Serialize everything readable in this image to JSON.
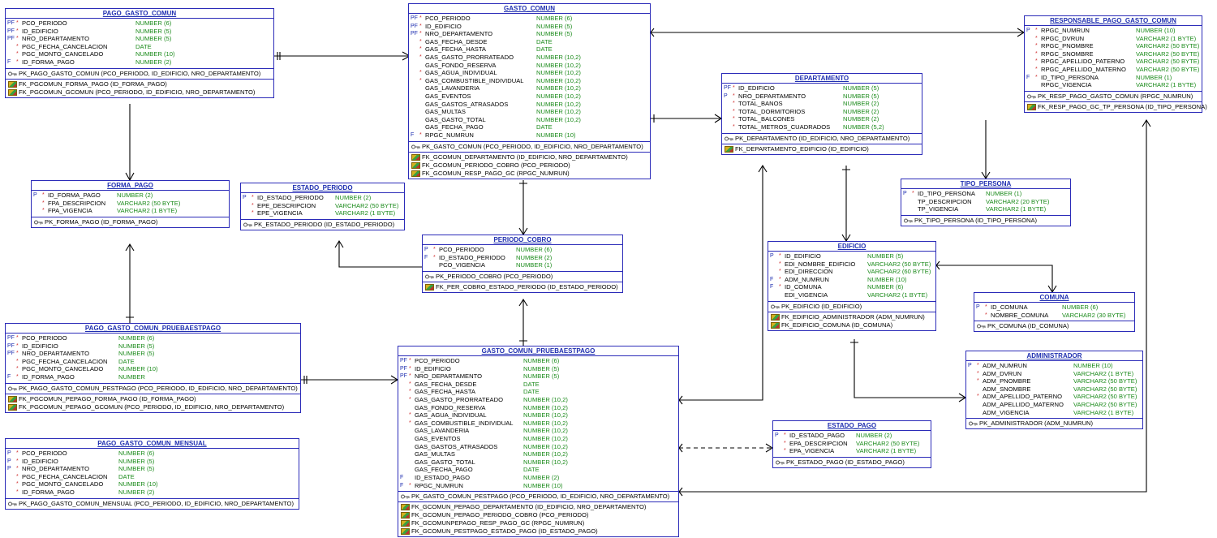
{
  "tables": [
    {
      "id": "pago_gasto_comun",
      "name": "PAGO_GASTO_COMUN",
      "columns": [
        [
          "PF",
          "*",
          "PCO_PERIODO",
          "NUMBER (6)"
        ],
        [
          "PF",
          "*",
          "ID_EDIFICIO",
          "NUMBER (5)"
        ],
        [
          "PF",
          "*",
          "NRO_DEPARTAMENTO",
          "NUMBER (5)"
        ],
        [
          "",
          "*",
          "PGC_FECHA_CANCELACION",
          "DATE"
        ],
        [
          "",
          "*",
          "PGC_MONTO_CANCELADO",
          "NUMBER (10)"
        ],
        [
          "F",
          "*",
          "ID_FORMA_PAGO",
          "NUMBER (2)"
        ]
      ],
      "pk": [
        "PK_PAGO_GASTO_COMUN (PCO_PERIODO, ID_EDIFICIO, NRO_DEPARTAMENTO)"
      ],
      "fk": [
        "FK_PGCOMUN_FORMA_PAGO (ID_FORMA_PAGO)",
        "FK_PGCOMUN_GCOMUN (PCO_PERIODO, ID_EDIFICIO, NRO_DEPARTAMENTO)"
      ]
    },
    {
      "id": "gasto_comun",
      "name": "GASTO_COMUN",
      "columns": [
        [
          "PF",
          "*",
          "PCO_PERIODO",
          "NUMBER (6)"
        ],
        [
          "PF",
          "*",
          "ID_EDIFICIO",
          "NUMBER (5)"
        ],
        [
          "PF",
          "*",
          "NRO_DEPARTAMENTO",
          "NUMBER (5)"
        ],
        [
          "",
          "*",
          "GAS_FECHA_DESDE",
          "DATE"
        ],
        [
          "",
          "*",
          "GAS_FECHA_HASTA",
          "DATE"
        ],
        [
          "",
          "*",
          "GAS_GASTO_PRORRATEADO",
          "NUMBER (10,2)"
        ],
        [
          "",
          "",
          "GAS_FONDO_RESERVA",
          "NUMBER (10,2)"
        ],
        [
          "",
          "*",
          "GAS_AGUA_INDIVIDUAL",
          "NUMBER (10,2)"
        ],
        [
          "",
          "*",
          "GAS_COMBUSTIBLE_INDIVIDUAL",
          "NUMBER (10,2)"
        ],
        [
          "",
          "",
          "GAS_LAVANDERIA",
          "NUMBER (10,2)"
        ],
        [
          "",
          "",
          "GAS_EVENTOS",
          "NUMBER (10,2)"
        ],
        [
          "",
          "",
          "GAS_GASTOS_ATRASADOS",
          "NUMBER (10,2)"
        ],
        [
          "",
          "",
          "GAS_MULTAS",
          "NUMBER (10,2)"
        ],
        [
          "",
          "",
          "GAS_GASTO_TOTAL",
          "NUMBER (10,2)"
        ],
        [
          "",
          "",
          "GAS_FECHA_PAGO",
          "DATE"
        ],
        [
          "F",
          "*",
          "RPGC_NUMRUN",
          "NUMBER (10)"
        ]
      ],
      "pk": [
        "PK_GASTO_COMUN (PCO_PERIODO, ID_EDIFICIO, NRO_DEPARTAMENTO)"
      ],
      "fk": [
        "FK_GCOMUN_DEPARTAMENTO (ID_EDIFICIO, NRO_DEPARTAMENTO)",
        "FK_GCOMUN_PERIODO_COBRO (PCO_PERIODO)",
        "FK_GCOMUN_RESP_PAGO_GC (RPGC_NUMRUN)"
      ]
    },
    {
      "id": "responsable_pago",
      "name": "RESPONSABLE_PAGO_GASTO_COMUN",
      "columns": [
        [
          "P",
          "*",
          "RPGC_NUMRUN",
          "NUMBER (10)"
        ],
        [
          "",
          "*",
          "RPGC_DVRUN",
          "VARCHAR2 (1 BYTE)"
        ],
        [
          "",
          "*",
          "RPGC_PNOMBRE",
          "VARCHAR2 (50 BYTE)"
        ],
        [
          "",
          "*",
          "RPGC_SNOMBRE",
          "VARCHAR2 (50 BYTE)"
        ],
        [
          "",
          "*",
          "RPGC_APELLIDO_PATERNO",
          "VARCHAR2 (50 BYTE)"
        ],
        [
          "",
          "*",
          "RPGC_APELLIDO_MATERNO",
          "VARCHAR2 (50 BYTE)"
        ],
        [
          "F",
          "*",
          "ID_TIPO_PERSONA",
          "NUMBER (1)"
        ],
        [
          "",
          "",
          "RPGC_VIGENCIA",
          "VARCHAR2 (1 BYTE)"
        ]
      ],
      "pk": [
        "PK_RESP_PAGO_GASTO_COMUN (RPGC_NUMRUN)"
      ],
      "fk": [
        "FK_RESP_PAGO_GC_TP_PERSONA (ID_TIPO_PERSONA)"
      ]
    },
    {
      "id": "departamento",
      "name": "DEPARTAMENTO",
      "columns": [
        [
          "PF",
          "*",
          "ID_EDIFICIO",
          "NUMBER (5)"
        ],
        [
          "P",
          "*",
          "NRO_DEPARTAMENTO",
          "NUMBER (5)"
        ],
        [
          "",
          "*",
          "TOTAL_BANOS",
          "NUMBER (2)"
        ],
        [
          "",
          "*",
          "TOTAL_DORMITORIOS",
          "NUMBER (2)"
        ],
        [
          "",
          "*",
          "TOTAL_BALCONES",
          "NUMBER (2)"
        ],
        [
          "",
          "*",
          "TOTAL_METROS_CUADRADOS",
          "NUMBER (5,2)"
        ]
      ],
      "pk": [
        "PK_DEPARTAMENTO (ID_EDIFICIO, NRO_DEPARTAMENTO)"
      ],
      "fk": [
        "FK_DEPARTAMENTO_EDIFICIO (ID_EDIFICIO)"
      ]
    },
    {
      "id": "forma_pago",
      "name": "FORMA_PAGO",
      "columns": [
        [
          "P",
          "*",
          "ID_FORMA_PAGO",
          "NUMBER (2)"
        ],
        [
          "",
          "*",
          "FPA_DESCRIPCION",
          "VARCHAR2 (50 BYTE)"
        ],
        [
          "",
          "*",
          "FPA_VIGENCIA",
          "VARCHAR2 (1 BYTE)"
        ]
      ],
      "pk": [
        "PK_FORMA_PAGO (ID_FORMA_PAGO)"
      ],
      "fk": []
    },
    {
      "id": "estado_periodo",
      "name": "ESTADO_PERIODO",
      "columns": [
        [
          "P",
          "*",
          "ID_ESTADO_PERIODO",
          "NUMBER (2)"
        ],
        [
          "",
          "*",
          "EPE_DESCRIPCION",
          "VARCHAR2 (50 BYTE)"
        ],
        [
          "",
          "*",
          "EPE_VIGENCIA",
          "VARCHAR2 (1 BYTE)"
        ]
      ],
      "pk": [
        "PK_ESTADO_PERIODO (ID_ESTADO_PERIODO)"
      ],
      "fk": []
    },
    {
      "id": "tipo_persona",
      "name": "TIPO_PERSONA",
      "columns": [
        [
          "P",
          "*",
          "ID_TIPO_PERSONA",
          "NUMBER (1)"
        ],
        [
          "",
          "",
          "TP_DESCRIPCION",
          "VARCHAR2 (20 BYTE)"
        ],
        [
          "",
          "",
          "TP_VIGENCIA",
          "VARCHAR2 (1 BYTE)"
        ]
      ],
      "pk": [
        "PK_TIPO_PERSONA (ID_TIPO_PERSONA)"
      ],
      "fk": []
    },
    {
      "id": "periodo_cobro",
      "name": "PERIODO_COBRO",
      "columns": [
        [
          "P",
          "*",
          "PCO_PERIODO",
          "NUMBER (6)"
        ],
        [
          "F",
          "*",
          "ID_ESTADO_PERIODO",
          "NUMBER (2)"
        ],
        [
          "",
          "",
          "PCO_VIGENCIA",
          "NUMBER (1)"
        ]
      ],
      "pk": [
        "PK_PERIODO_COBRO (PCO_PERIODO)"
      ],
      "fk": [
        "FK_PER_COBRO_ESTADO_PERIODO (ID_ESTADO_PERIODO)"
      ]
    },
    {
      "id": "edificio",
      "name": "EDIFICIO",
      "columns": [
        [
          "P",
          "*",
          "ID_EDIFICIO",
          "NUMBER (5)"
        ],
        [
          "",
          "*",
          "EDI_NOMBRE_EDIFICIO",
          "VARCHAR2 (50 BYTE)"
        ],
        [
          "",
          "*",
          "EDI_DIRECCION",
          "VARCHAR2 (60 BYTE)"
        ],
        [
          "F",
          "*",
          "ADM_NUMRUN",
          "NUMBER (10)"
        ],
        [
          "F",
          "*",
          "ID_COMUNA",
          "NUMBER (6)"
        ],
        [
          "",
          "",
          "EDI_VIGENCIA",
          "VARCHAR2 (1 BYTE)"
        ]
      ],
      "pk": [
        "PK_EDIFICIO (ID_EDIFICIO)"
      ],
      "fk": [
        "FK_EDIFICIO_ADMINISTRADOR (ADM_NUMRUN)",
        "FK_EDIFICIO_COMUNA (ID_COMUNA)"
      ]
    },
    {
      "id": "comuna",
      "name": "COMUNA",
      "columns": [
        [
          "P",
          "*",
          "ID_COMUNA",
          "NUMBER (6)"
        ],
        [
          "",
          "*",
          "NOMBRE_COMUNA",
          "VARCHAR2 (30 BYTE)"
        ]
      ],
      "pk": [
        "PK_COMUNA (ID_COMUNA)"
      ],
      "fk": []
    },
    {
      "id": "pgc_pruebaestpago",
      "name": "PAGO_GASTO_COMUN_PRUEBAESTPAGO",
      "columns": [
        [
          "PF",
          "*",
          "PCO_PERIODO",
          "NUMBER (6)"
        ],
        [
          "PF",
          "*",
          "ID_EDIFICIO",
          "NUMBER (5)"
        ],
        [
          "PF",
          "*",
          "NRO_DEPARTAMENTO",
          "NUMBER (5)"
        ],
        [
          "",
          "*",
          "PGC_FECHA_CANCELACION",
          "DATE"
        ],
        [
          "",
          "*",
          "PGC_MONTO_CANCELADO",
          "NUMBER (10)"
        ],
        [
          "F",
          "*",
          "ID_FORMA_PAGO",
          "NUMBER"
        ]
      ],
      "pk": [
        "PK_PAGO_GASTO_COMUN_PESTPAGO (PCO_PERIODO, ID_EDIFICIO, NRO_DEPARTAMENTO)"
      ],
      "fk": [
        "FK_PGCOMUN_PEPAGO_FORMA_PAGO (ID_FORMA_PAGO)",
        "FK_PGCOMUN_PEPAGO_GCOMUN (PCO_PERIODO, ID_EDIFICIO, NRO_DEPARTAMENTO)"
      ]
    },
    {
      "id": "gc_pruebaestpago",
      "name": "GASTO_COMUN_PRUEBAESTPAGO",
      "columns": [
        [
          "PF",
          "*",
          "PCO_PERIODO",
          "NUMBER (6)"
        ],
        [
          "PF",
          "*",
          "ID_EDIFICIO",
          "NUMBER (5)"
        ],
        [
          "PF",
          "*",
          "NRO_DEPARTAMENTO",
          "NUMBER (5)"
        ],
        [
          "",
          "*",
          "GAS_FECHA_DESDE",
          "DATE"
        ],
        [
          "",
          "*",
          "GAS_FECHA_HASTA",
          "DATE"
        ],
        [
          "",
          "*",
          "GAS_GASTO_PRORRATEADO",
          "NUMBER (10,2)"
        ],
        [
          "",
          "",
          "GAS_FONDO_RESERVA",
          "NUMBER (10,2)"
        ],
        [
          "",
          "*",
          "GAS_AGUA_INDIVIDUAL",
          "NUMBER (10,2)"
        ],
        [
          "",
          "*",
          "GAS_COMBUSTIBLE_INDIVIDUAL",
          "NUMBER (10,2)"
        ],
        [
          "",
          "",
          "GAS_LAVANDERIA",
          "NUMBER (10,2)"
        ],
        [
          "",
          "",
          "GAS_EVENTOS",
          "NUMBER (10,2)"
        ],
        [
          "",
          "",
          "GAS_GASTOS_ATRASADOS",
          "NUMBER (10,2)"
        ],
        [
          "",
          "",
          "GAS_MULTAS",
          "NUMBER (10,2)"
        ],
        [
          "",
          "",
          "GAS_GASTO_TOTAL",
          "NUMBER (10,2)"
        ],
        [
          "",
          "",
          "GAS_FECHA_PAGO",
          "DATE"
        ],
        [
          "F",
          "",
          "ID_ESTADO_PAGO",
          "NUMBER (2)"
        ],
        [
          "F",
          "*",
          "RPGC_NUMRUN",
          "NUMBER (10)"
        ]
      ],
      "pk": [
        "PK_GASTO_COMUN_PESTPAGO (PCO_PERIODO, ID_EDIFICIO, NRO_DEPARTAMENTO)"
      ],
      "fk": [
        "FK_GCOMUN_PEPAGO_DEPARTAMENTO (ID_EDIFICIO, NRO_DEPARTAMENTO)",
        "FK_GCOMUN_PEPAGO_PERIODO_COBRO (PCO_PERIODO)",
        "FK_GCOMUNPEPAGO_RESP_PAGO_GC (RPGC_NUMRUN)",
        "FK_GCOMUN_PESTPAGO_ESTADO_PAGO (ID_ESTADO_PAGO)"
      ]
    },
    {
      "id": "administrador",
      "name": "ADMINISTRADOR",
      "columns": [
        [
          "P",
          "*",
          "ADM_NUMRUN",
          "NUMBER (10)"
        ],
        [
          "",
          "*",
          "ADM_DVRUN",
          "VARCHAR2 (1 BYTE)"
        ],
        [
          "",
          "*",
          "ADM_PNOMBRE",
          "VARCHAR2 (50 BYTE)"
        ],
        [
          "",
          "",
          "ADM_SNOMBRE",
          "VARCHAR2 (50 BYTE)"
        ],
        [
          "",
          "*",
          "ADM_APELLIDO_PATERNO",
          "VARCHAR2 (50 BYTE)"
        ],
        [
          "",
          "",
          "ADM_APELLIDO_MATERNO",
          "VARCHAR2 (50 BYTE)"
        ],
        [
          "",
          "",
          "ADM_VIGENCIA",
          "VARCHAR2 (1 BYTE)"
        ]
      ],
      "pk": [
        "PK_ADMINISTRADOR (ADM_NUMRUN)"
      ],
      "fk": []
    },
    {
      "id": "pgc_mensual",
      "name": "PAGO_GASTO_COMUN_MENSUAL",
      "columns": [
        [
          "P",
          "*",
          "PCO_PERIODO",
          "NUMBER (6)"
        ],
        [
          "P",
          "*",
          "ID_EDIFICIO",
          "NUMBER (5)"
        ],
        [
          "P",
          "*",
          "NRO_DEPARTAMENTO",
          "NUMBER (5)"
        ],
        [
          "",
          "*",
          "PGC_FECHA_CANCELACION",
          "DATE"
        ],
        [
          "",
          "*",
          "PGC_MONTO_CANCELADO",
          "NUMBER (10)"
        ],
        [
          "",
          "*",
          "ID_FORMA_PAGO",
          "NUMBER (2)"
        ]
      ],
      "pk": [
        "PK_PAGO_GASTO_COMUN_MENSUAL (PCO_PERIODO, ID_EDIFICIO, NRO_DEPARTAMENTO)"
      ],
      "fk": []
    },
    {
      "id": "estado_pago",
      "name": "ESTADO_PAGO",
      "columns": [
        [
          "P",
          "*",
          "ID_ESTADO_PAGO",
          "NUMBER (2)"
        ],
        [
          "",
          "*",
          "EPA_DESCRIPCION",
          "VARCHAR2 (50 BYTE)"
        ],
        [
          "",
          "*",
          "EPA_VIGENCIA",
          "VARCHAR2 (1 BYTE)"
        ]
      ],
      "pk": [
        "PK_ESTADO_PAGO (ID_ESTADO_PAGO)"
      ],
      "fk": []
    }
  ],
  "colors": {
    "border": "#2b2bb8",
    "title": "#1f2fb0",
    "type": "#1a8a1a",
    "required": "#d03030",
    "line": "#000000"
  }
}
